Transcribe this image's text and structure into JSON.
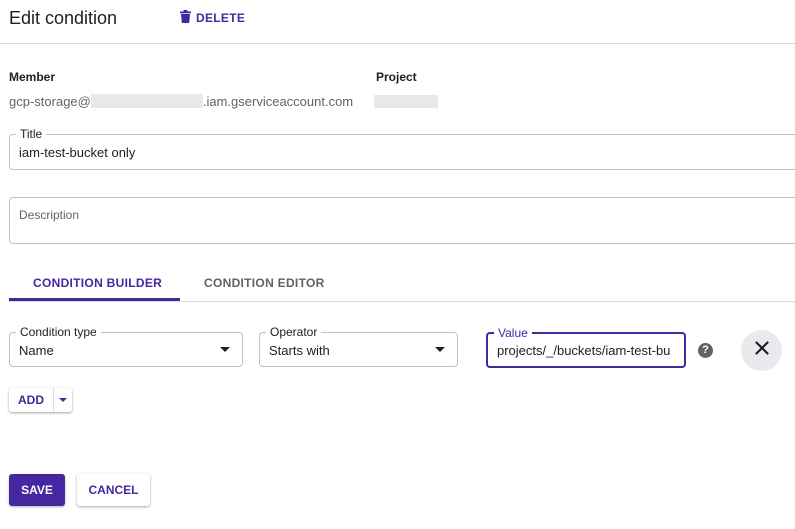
{
  "header": {
    "title": "Edit condition",
    "delete_label": "DELETE"
  },
  "info": {
    "member_label": "Member",
    "member_prefix": "gcp-storage@",
    "member_suffix": ".iam.gserviceaccount.com",
    "project_label": "Project"
  },
  "form": {
    "title_label": "Title",
    "title_value": "iam-test-bucket only",
    "description_label": "Description",
    "description_value": ""
  },
  "tabs": [
    {
      "label": "CONDITION BUILDER",
      "active": true
    },
    {
      "label": "CONDITION EDITOR",
      "active": false
    }
  ],
  "condition": {
    "type_label": "Condition type",
    "type_value": "Name",
    "operator_label": "Operator",
    "operator_value": "Starts with",
    "value_label": "Value",
    "value_value": "projects/_/buckets/iam-test-bu"
  },
  "actions": {
    "add_label": "ADD",
    "save_label": "SAVE",
    "cancel_label": "CANCEL"
  },
  "icons": {
    "help": "?"
  },
  "colors": {
    "accent": "#4527a0",
    "border": "#bdc1c6",
    "divider": "#dadce0"
  }
}
